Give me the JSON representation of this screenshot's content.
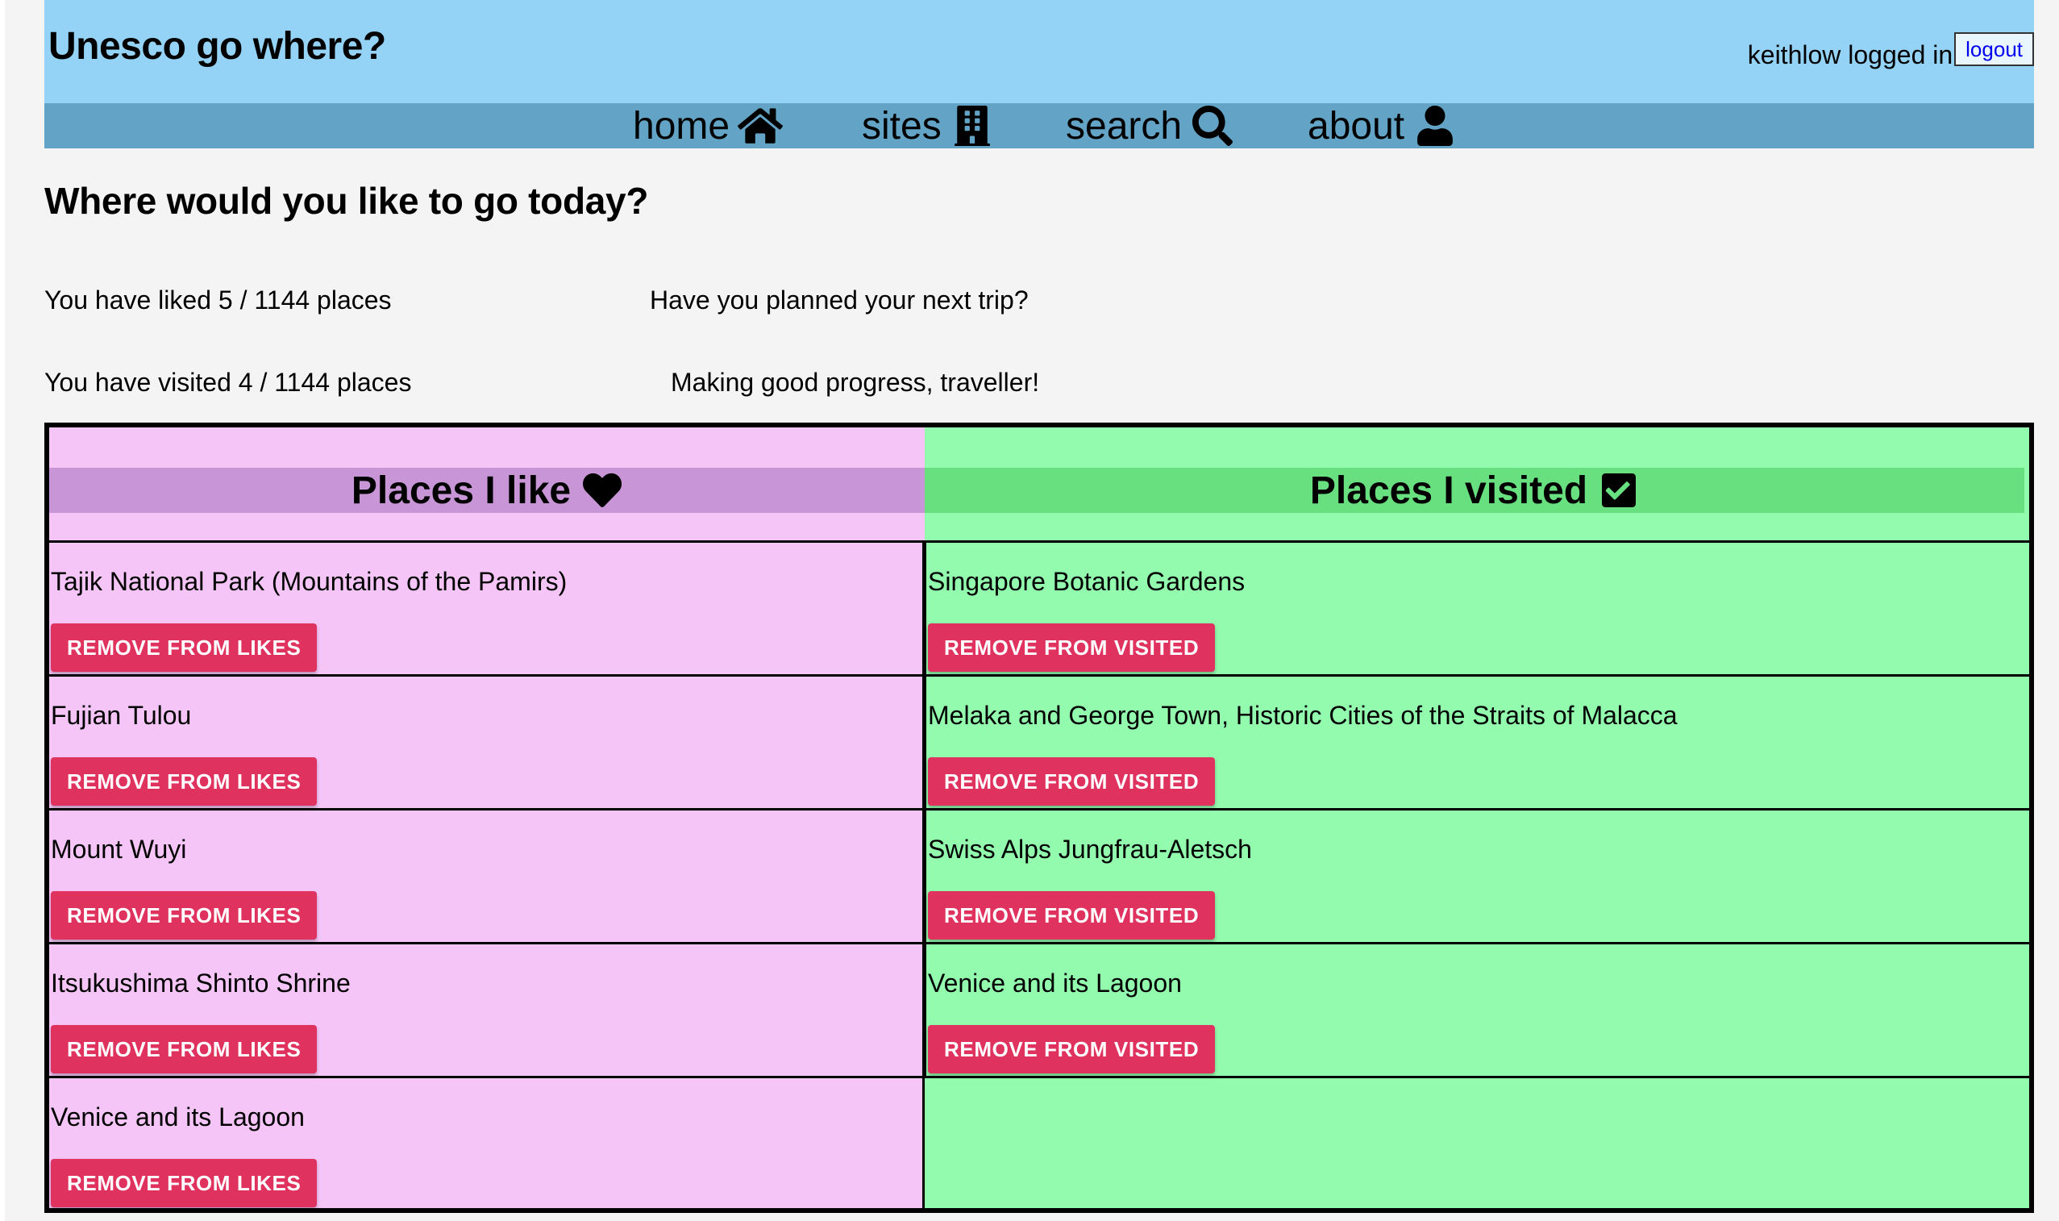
{
  "header": {
    "app_title": "Unesco go where?",
    "user_text": "keithlow logged in",
    "logout_label": "logout"
  },
  "nav": {
    "home": "home",
    "sites": "sites",
    "search": "search",
    "about": "about"
  },
  "main": {
    "title": "Where would you like to go today?",
    "liked_stat": "You have liked 5 / 1144 places",
    "liked_message": "Have you planned your next trip?",
    "visited_stat": "You have visited 4 / 1144 places",
    "visited_message": "Making good progress, traveller!"
  },
  "likes": {
    "header": "Places I like",
    "button_label": "REMOVE FROM LIKES",
    "items": [
      "Tajik National Park (Mountains of the Pamirs)",
      "Fujian Tulou",
      "Mount Wuyi",
      "Itsukushima Shinto Shrine",
      "Venice and its Lagoon"
    ]
  },
  "visited": {
    "header": "Places I visited",
    "button_label": "REMOVE FROM VISITED",
    "items": [
      "Singapore Botanic Gardens",
      "Melaka and George Town, Historic Cities of the Straits of Malacca",
      "Swiss Alps Jungfrau-Aletsch",
      "Venice and its Lagoon"
    ]
  },
  "colors": {
    "header_bg": "#94d3f6",
    "nav_bg": "#62a3c6",
    "likes_bg": "#f5c5f7",
    "likes_header_bg": "#c896d6",
    "visited_bg": "#93fbad",
    "visited_header_bg": "#68e080",
    "button_bg": "#e0325e"
  },
  "icons": {
    "home": "home-icon",
    "sites": "building-icon",
    "search": "search-icon",
    "about": "user-icon",
    "likes_header": "heart-icon",
    "visited_header": "check-square-icon"
  }
}
